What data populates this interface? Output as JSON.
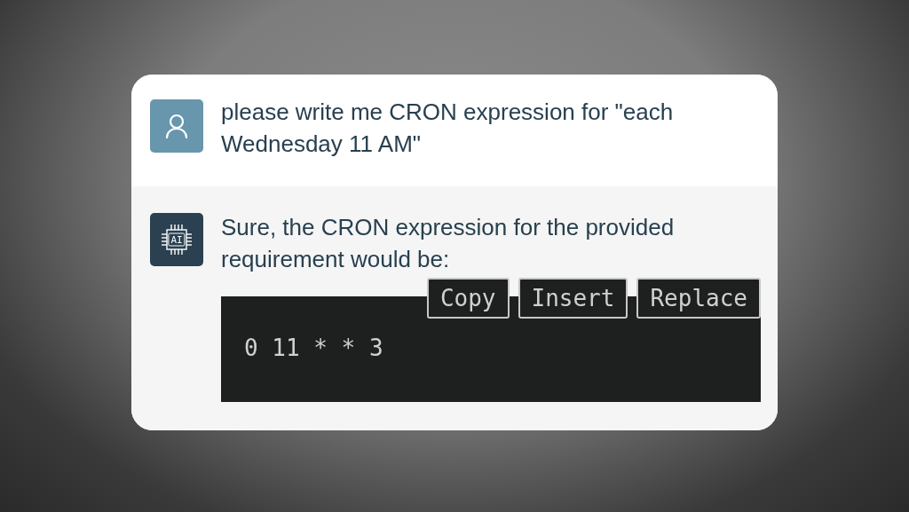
{
  "messages": [
    {
      "kind": "user",
      "text": "please write me CRON expression for \"each Wednesday 11 AM\""
    },
    {
      "kind": "assistant",
      "avatar_label": "AI",
      "text": "Sure, the CRON expression for the provided requirement would be:",
      "code": "0 11 * * 3",
      "actions": [
        "Copy",
        "Insert",
        "Replace"
      ]
    }
  ]
}
